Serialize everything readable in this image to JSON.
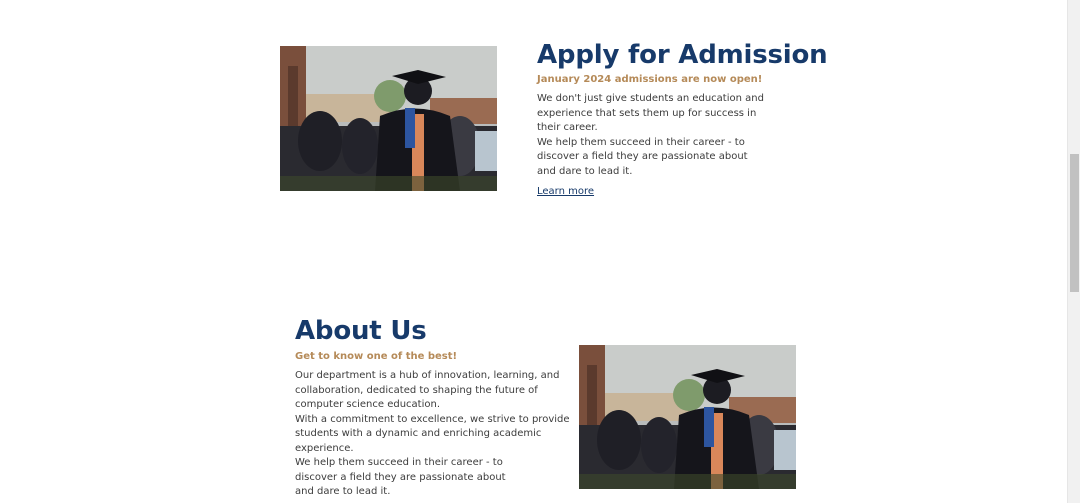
{
  "admission": {
    "title": "Apply for Admission",
    "subtitle": "January 2024 admissions are now open!",
    "lines": [
      "We don't just give students an education and",
      "experience that sets them up for success in",
      "their career.",
      "We help them succeed in their career - to",
      "discover a field they are passionate about",
      "and dare to lead it."
    ],
    "link_label": "Learn more"
  },
  "about": {
    "title": "About Us",
    "subtitle": "Get to know one of the best!",
    "lines": [
      "Our department is a hub of innovation, learning, and",
      "collaboration, dedicated to shaping the future of",
      "computer science education.",
      "With a commitment to excellence, we strive to provide",
      "students with a dynamic and enriching academic",
      "experience.",
      "We help them succeed in their career - to",
      "discover a field they are passionate about",
      "and dare to lead it."
    ]
  },
  "colors": {
    "title": "#173a6a",
    "subtitle": "#b58a58",
    "body": "#3c3c3c"
  },
  "images": {
    "photo_subject": "graduation-photo"
  }
}
